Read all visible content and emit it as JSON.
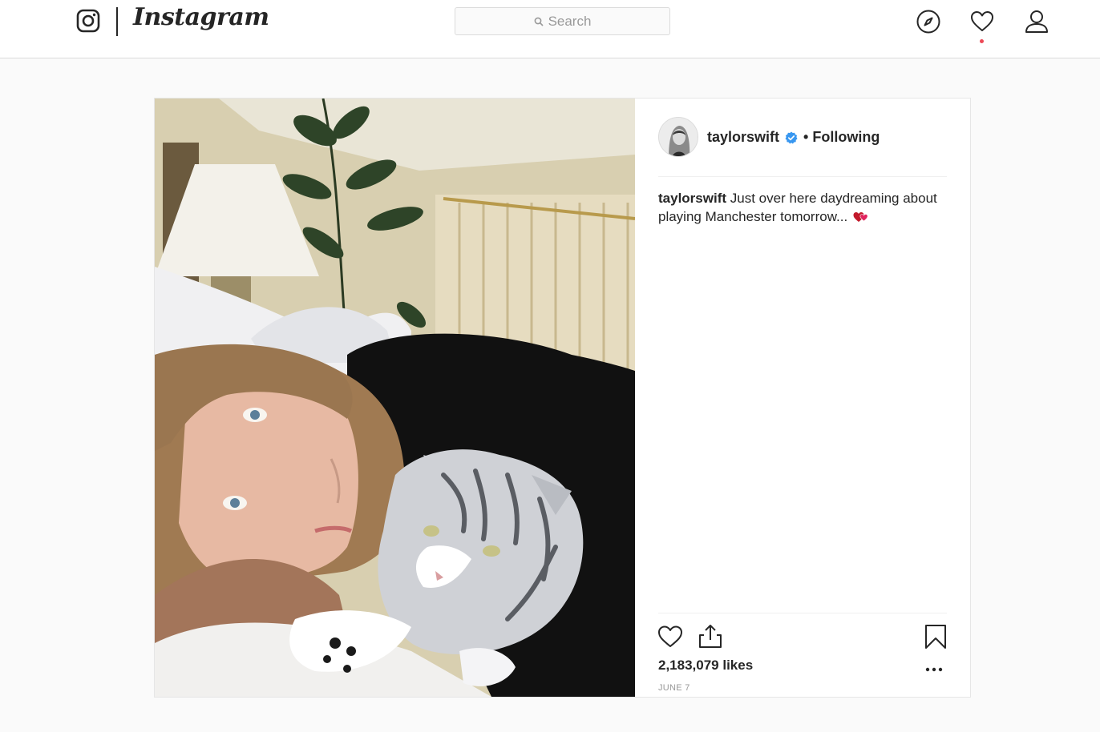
{
  "topbar": {
    "logo_text": "Instagram",
    "search_placeholder": "Search",
    "icons": [
      "instagram-glyph-icon",
      "search-icon",
      "compass-icon",
      "heart-icon",
      "profile-icon"
    ],
    "notification_dot_color": "#ed4956"
  },
  "post": {
    "username": "taylorswift",
    "verified": true,
    "separator": "•",
    "follow_status": "Following",
    "caption_user": "taylorswift",
    "caption_text": "Just over here daydreaming about playing Manchester tomorrow...",
    "caption_emoji": "two-hearts",
    "likes": "2,183,079 likes",
    "date": "JUNE 7",
    "actions": [
      "like-icon",
      "share-icon",
      "bookmark-icon",
      "more-options-icon"
    ]
  },
  "colors": {
    "accent_blue": "#3897f0",
    "text": "#262626",
    "muted": "#999999",
    "border": "#dbdbdb",
    "emoji_red": "#e0245e"
  }
}
